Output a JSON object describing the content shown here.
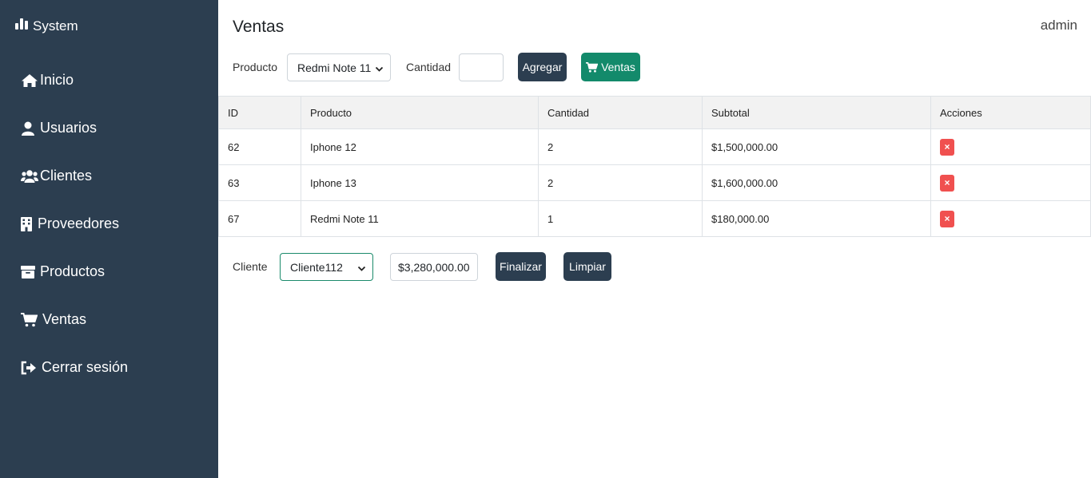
{
  "app": {
    "title": "System",
    "user": "admin"
  },
  "sidebar": {
    "items": [
      {
        "label": "Inicio",
        "icon": "home-icon"
      },
      {
        "label": "Usuarios",
        "icon": "user-icon"
      },
      {
        "label": "Clientes",
        "icon": "users-icon"
      },
      {
        "label": "Proveedores",
        "icon": "building-icon"
      },
      {
        "label": "Productos",
        "icon": "box-icon"
      },
      {
        "label": "Ventas",
        "icon": "cart-icon"
      },
      {
        "label": "Cerrar sesión",
        "icon": "sign-out-icon"
      }
    ]
  },
  "page": {
    "title": "Ventas"
  },
  "form": {
    "product_label": "Producto",
    "product_selected": "Redmi Note 11",
    "quantity_label": "Cantidad",
    "quantity_value": "",
    "add_button": "Agregar",
    "sales_button": "Ventas"
  },
  "table": {
    "headers": [
      "ID",
      "Producto",
      "Cantidad",
      "Subtotal",
      "Acciones"
    ],
    "rows": [
      {
        "id": "62",
        "product": "Iphone 12",
        "quantity": "2",
        "subtotal": "$1,500,000.00"
      },
      {
        "id": "63",
        "product": "Iphone 13",
        "quantity": "2",
        "subtotal": "$1,600,000.00"
      },
      {
        "id": "67",
        "product": "Redmi Note 11",
        "quantity": "1",
        "subtotal": "$180,000.00"
      }
    ],
    "delete_glyph": "×"
  },
  "footer": {
    "client_label": "Cliente",
    "client_selected": "Cliente112",
    "total_value": "$3,280,000.00",
    "finish_button": "Finalizar",
    "clear_button": "Limpiar"
  },
  "colors": {
    "sidebar": "#2c3e50",
    "accent_green": "#138a6b",
    "danger": "#f0504f"
  }
}
